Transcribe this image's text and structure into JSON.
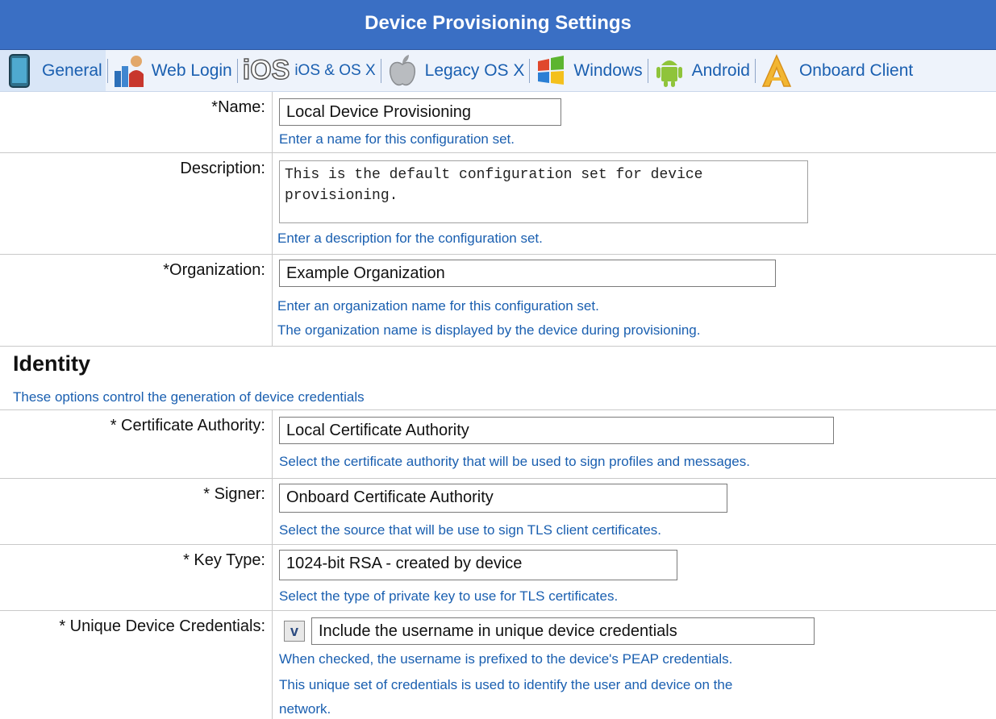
{
  "header": {
    "title": "Device Provisioning Settings"
  },
  "tabs": [
    {
      "label": "General",
      "icon": "tablet-icon"
    },
    {
      "label": "Web Login",
      "icon": "users-icon"
    },
    {
      "label": "iOS & OS X",
      "icon": "ios-icon",
      "icon_text": "iOS"
    },
    {
      "label": "Legacy OS X",
      "icon": "apple-icon"
    },
    {
      "label": "Windows",
      "icon": "windows-icon"
    },
    {
      "label": "Android",
      "icon": "android-icon"
    },
    {
      "label": "Onboard Client",
      "icon": "onboard-icon"
    }
  ],
  "general": {
    "name": {
      "label": "*Name:",
      "value": "Local Device Provisioning",
      "hint": "Enter a name for this configuration set."
    },
    "description": {
      "label": "Description:",
      "value": "This is the default configuration set for device provisioning.",
      "hint": "Enter a description for the configuration set."
    },
    "organization": {
      "label": "*Organization:",
      "value": "Example Organization",
      "hint1": "Enter an organization name for this configuration set.",
      "hint2": "The organization name is displayed by the device during provisioning."
    }
  },
  "identity": {
    "title": "Identity",
    "description": "These options control the generation of device credentials",
    "certificate_authority": {
      "label": "* Certificate Authority:",
      "value": "Local Certificate Authority",
      "hint": "Select the certificate authority that will be used to sign profiles and messages."
    },
    "signer": {
      "label": "* Signer:",
      "value": "Onboard Certificate Authority",
      "hint": "Select the source that will be use to sign TLS client certificates."
    },
    "key_type": {
      "label": "* Key Type:",
      "value": "1024-bit RSA - created by device",
      "hint": "Select the type of private key to use for TLS certificates."
    },
    "unique_credentials": {
      "label": "* Unique Device Credentials:",
      "check_mark": "v",
      "checked": true,
      "checkbox_label": "Include the username in unique device credentials",
      "hint1": "When checked, the username is prefixed to the device's PEAP credentials.",
      "hint2": "This unique set of credentials is used to identify the user and device on the",
      "hint3": "network."
    }
  },
  "colors": {
    "header_bg": "#3a6fc4",
    "link_blue": "#1a5fb0"
  }
}
